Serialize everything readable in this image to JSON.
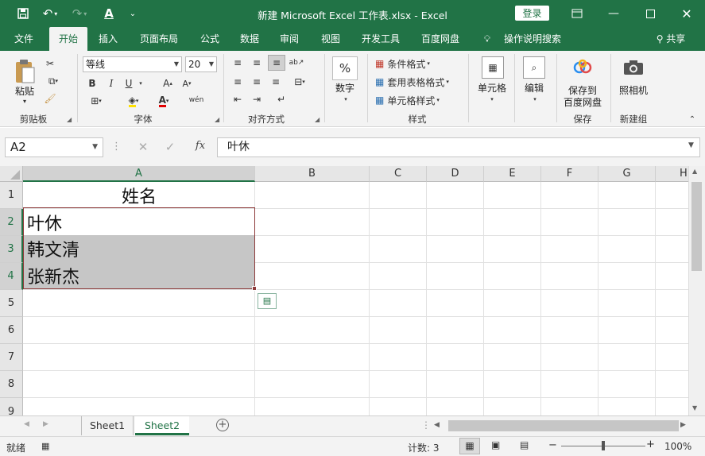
{
  "title_bar": {
    "title": "新建 Microsoft Excel 工作表.xlsx  -  Excel",
    "login": "登录"
  },
  "tabs": [
    "文件",
    "开始",
    "插入",
    "页面布局",
    "公式",
    "数据",
    "审阅",
    "视图",
    "开发工具",
    "百度网盘"
  ],
  "tell_me": "操作说明搜索",
  "share": "共享",
  "ribbon": {
    "clipboard": {
      "paste": "粘贴",
      "label": "剪贴板"
    },
    "font": {
      "name": "等线",
      "size": "20",
      "label": "字体",
      "bold": "B",
      "italic": "I",
      "underline": "U",
      "wen": "wén"
    },
    "alignment": {
      "label": "对齐方式"
    },
    "number": {
      "button": "数字",
      "icon_text": "%"
    },
    "styles": {
      "conditional": "条件格式",
      "table": "套用表格格式",
      "cell_styles": "单元格样式",
      "label": "样式"
    },
    "cells": {
      "button": "单元格"
    },
    "editing": {
      "button": "编辑"
    },
    "baidu": {
      "line1": "保存到",
      "line2": "百度网盘",
      "label": "保存"
    },
    "camera": {
      "button": "照相机",
      "label": "新建组"
    }
  },
  "formula_bar": {
    "name_box": "A2",
    "value": "叶休",
    "fx": "fx"
  },
  "columns": [
    "A",
    "B",
    "C",
    "D",
    "E",
    "F",
    "G",
    "H"
  ],
  "rows": [
    "1",
    "2",
    "3",
    "4",
    "5",
    "6",
    "7",
    "8",
    "9"
  ],
  "cells": {
    "A1": "姓名",
    "A2": "叶休",
    "A3": "韩文清",
    "A4": "张新杰"
  },
  "sheets": [
    "Sheet1",
    "Sheet2"
  ],
  "active_sheet": "Sheet2",
  "status": {
    "mode": "就绪",
    "count": "计数: 3",
    "zoom": "100%"
  },
  "colors": {
    "accent": "#217346",
    "selection_fill": "#c6c6c6",
    "selection_border": "#8e3b3b"
  }
}
